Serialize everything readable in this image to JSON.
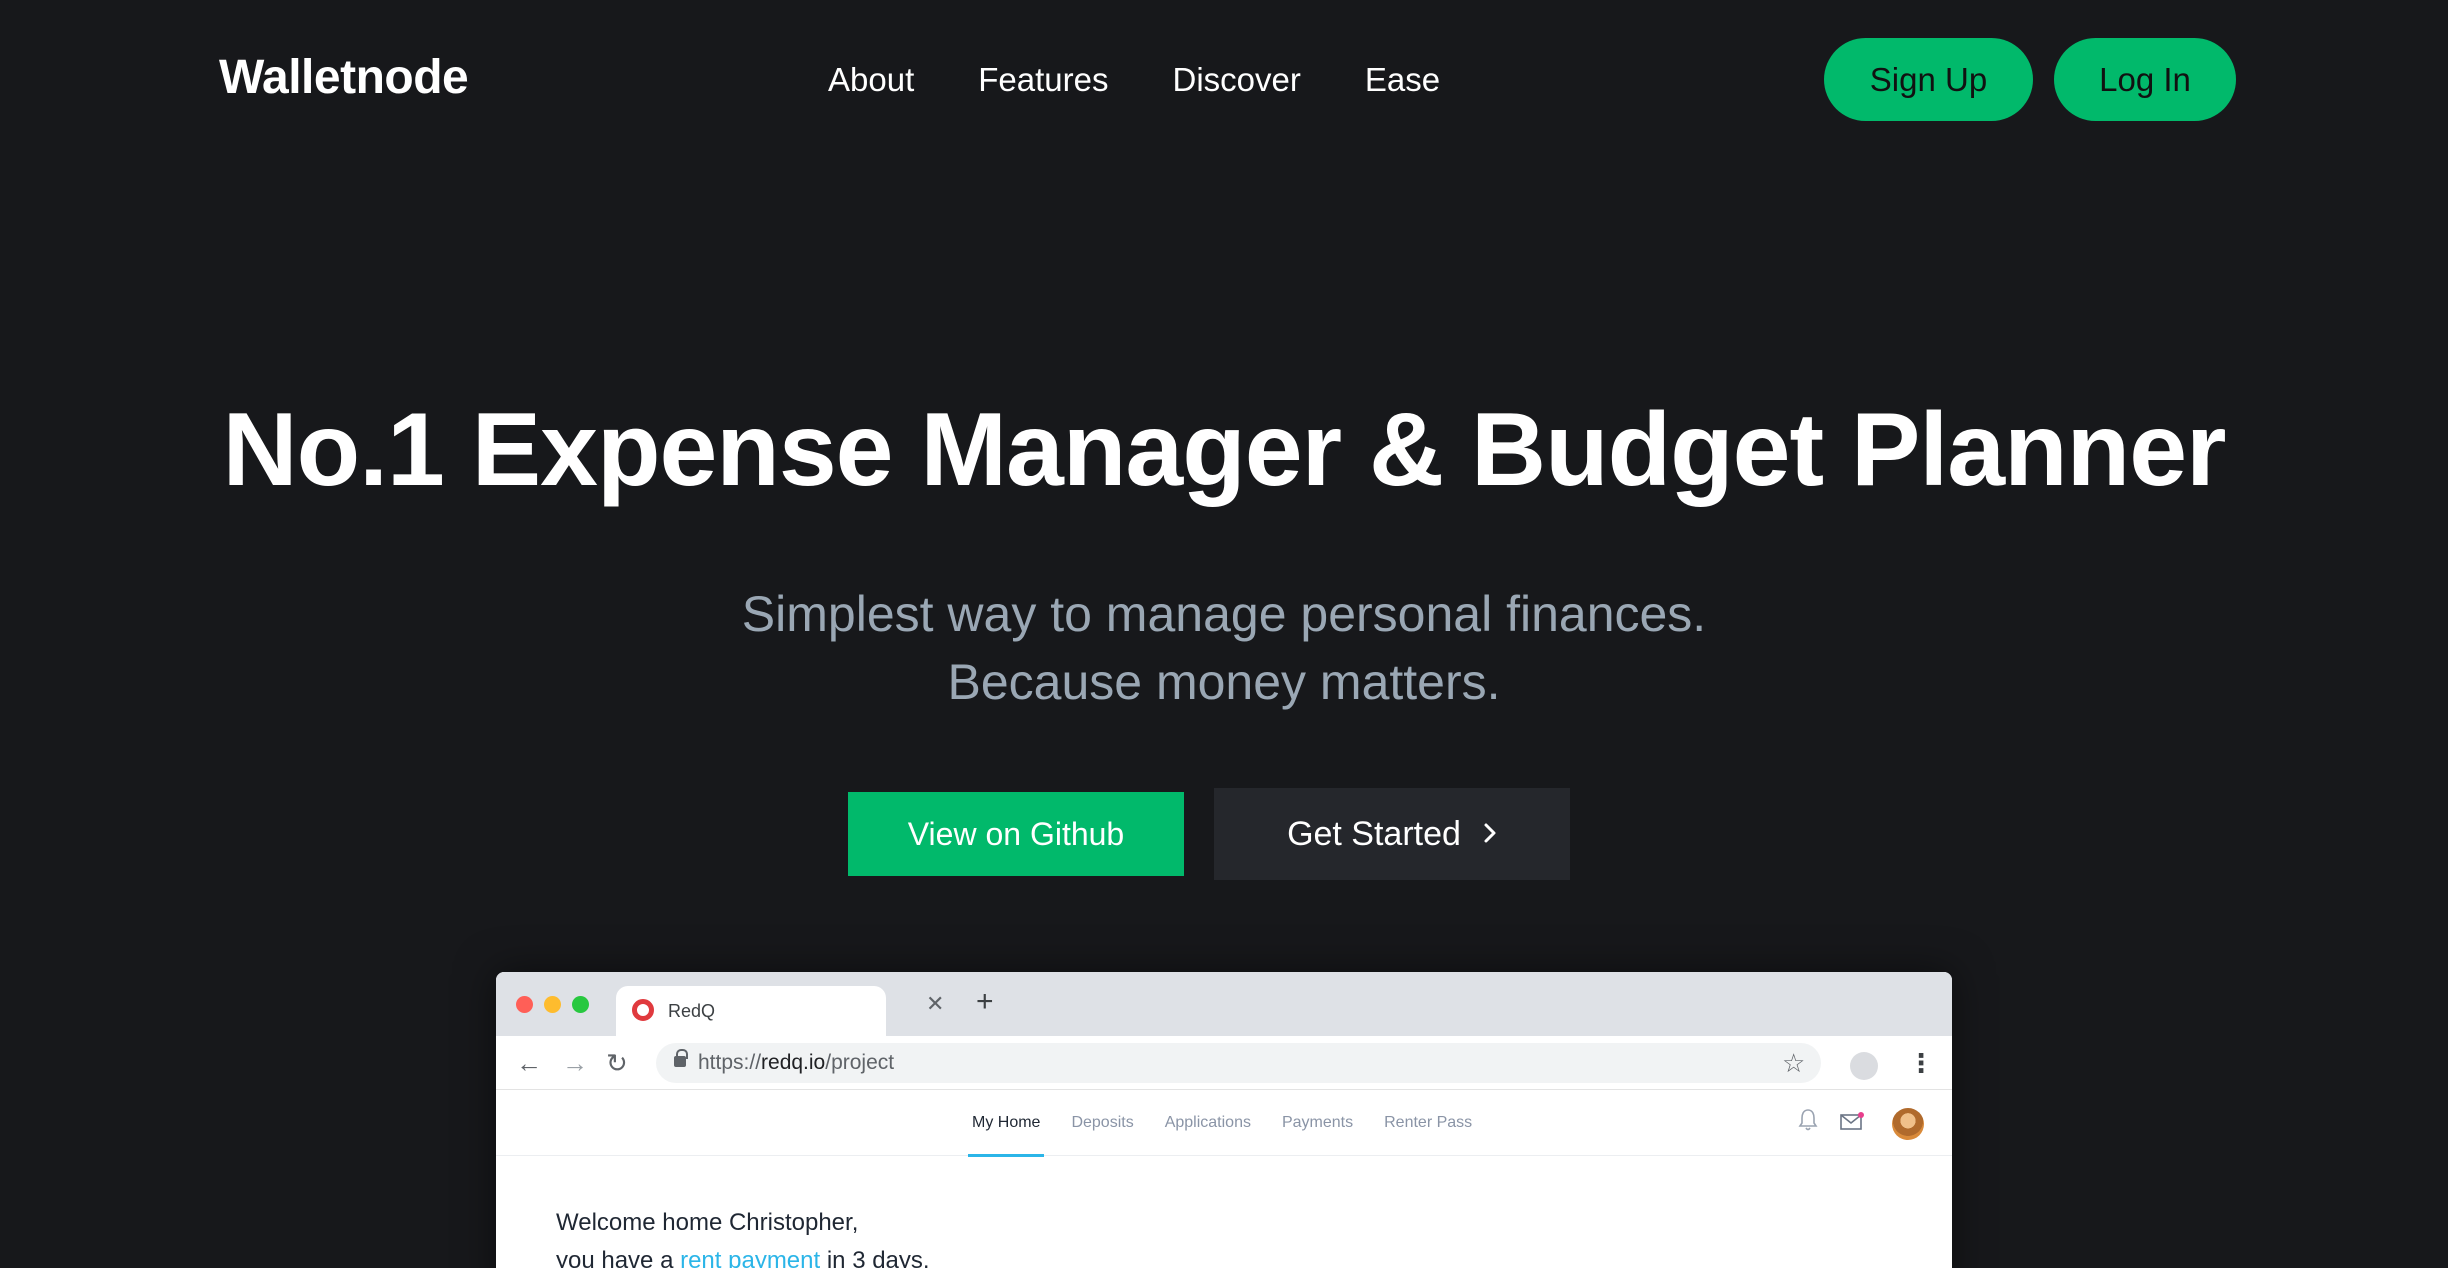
{
  "header": {
    "logo": "Walletnode",
    "nav": [
      "About",
      "Features",
      "Discover",
      "Ease"
    ],
    "signup_label": "Sign Up",
    "login_label": "Log In"
  },
  "hero": {
    "title": "No.1 Expense Manager & Budget Planner",
    "subtitle_line1": "Simplest way to manage personal finances.",
    "subtitle_line2": "Because money matters.",
    "github_label": "View on Github",
    "started_label": "Get Started",
    "started_icon": "chevron-right-icon"
  },
  "browser": {
    "tab_title": "RedQ",
    "url_scheme": "https://",
    "url_host": "redq.io",
    "url_path": "/project",
    "app_nav": [
      "My Home",
      "Deposits",
      "Applications",
      "Payments",
      "Renter Pass"
    ],
    "welcome_line1": "Welcome home Christopher,",
    "welcome_pre": "you have a ",
    "welcome_link": "rent payment",
    "welcome_post": " in 3 days."
  },
  "colors": {
    "background": "#17181b",
    "accent": "#01b96b",
    "muted_text": "#9aa7b4",
    "secondary_button": "#25272c"
  }
}
